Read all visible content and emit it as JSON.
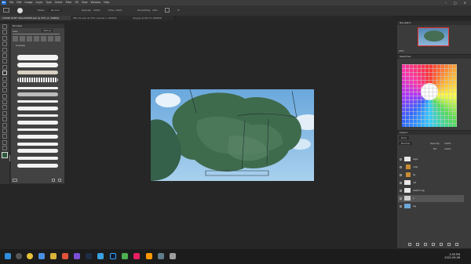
{
  "app": {
    "logo": "Ps",
    "menu": [
      "File",
      "Edit",
      "Image",
      "Layer",
      "Type",
      "Select",
      "Filter",
      "3D",
      "View",
      "Window",
      "Help"
    ],
    "window_controls": [
      "–",
      "□",
      "✕"
    ]
  },
  "options_bar": {
    "mode_label": "Mode:",
    "mode_value": "Normal",
    "opacity_label": "Opacity:",
    "opacity_value": "100%",
    "flow_label": "Flow:",
    "flow_value": "100%",
    "smoothing_label": "Smoothing:",
    "smoothing_value": "10%",
    "angle_value": "0°"
  },
  "doc_tabs": [
    "CHASE ZOEY WALLPAPER.psd @ 25% (1, RGB/8)",
    "IMG-01.psd @ 50% (Levels 1, RGB/8)",
    "sky.jpg @ 66.7% (RGB/8)"
  ],
  "brushes_panel": {
    "title": "Brushes",
    "size_label": "Size:",
    "size_value": "400 px",
    "group_label": "brushes"
  },
  "navigator": {
    "title": "Navigator",
    "zoom": "25%"
  },
  "swatches": {
    "title": "Swatches"
  },
  "layers_panel": {
    "title": "Layers",
    "kind_label": "Kind",
    "blend_mode": "Normal",
    "opacity_label": "Opacity:",
    "opacity_value": "100%",
    "fill_label": "Fill:",
    "fill_value": "100%",
    "layers": [
      {
        "name": "logo",
        "thumb_color": "#e8e8e8",
        "selected": false
      },
      {
        "name": "char",
        "thumb_color": "#c98b34",
        "selected": false
      },
      {
        "name": "fg",
        "thumb_color": "#c98b34",
        "selected": false
      },
      {
        "name": "ref",
        "thumb_color": "#e8e8e8",
        "selected": false
      },
      {
        "name": "sketch bg",
        "thumb_color": "#e8e8e8",
        "selected": false
      },
      {
        "name": "1",
        "thumb_color": "#d0d0d0",
        "selected": true
      },
      {
        "name": "bg",
        "thumb_color": "#6ea6d6",
        "selected": false
      }
    ]
  },
  "taskbar": {
    "time": "2:59 PM",
    "date": "2022-09-06"
  },
  "colors": {
    "accent": "#1c6fd6",
    "sky": "#8ec0e6",
    "foliage": "#3f6b4d"
  }
}
